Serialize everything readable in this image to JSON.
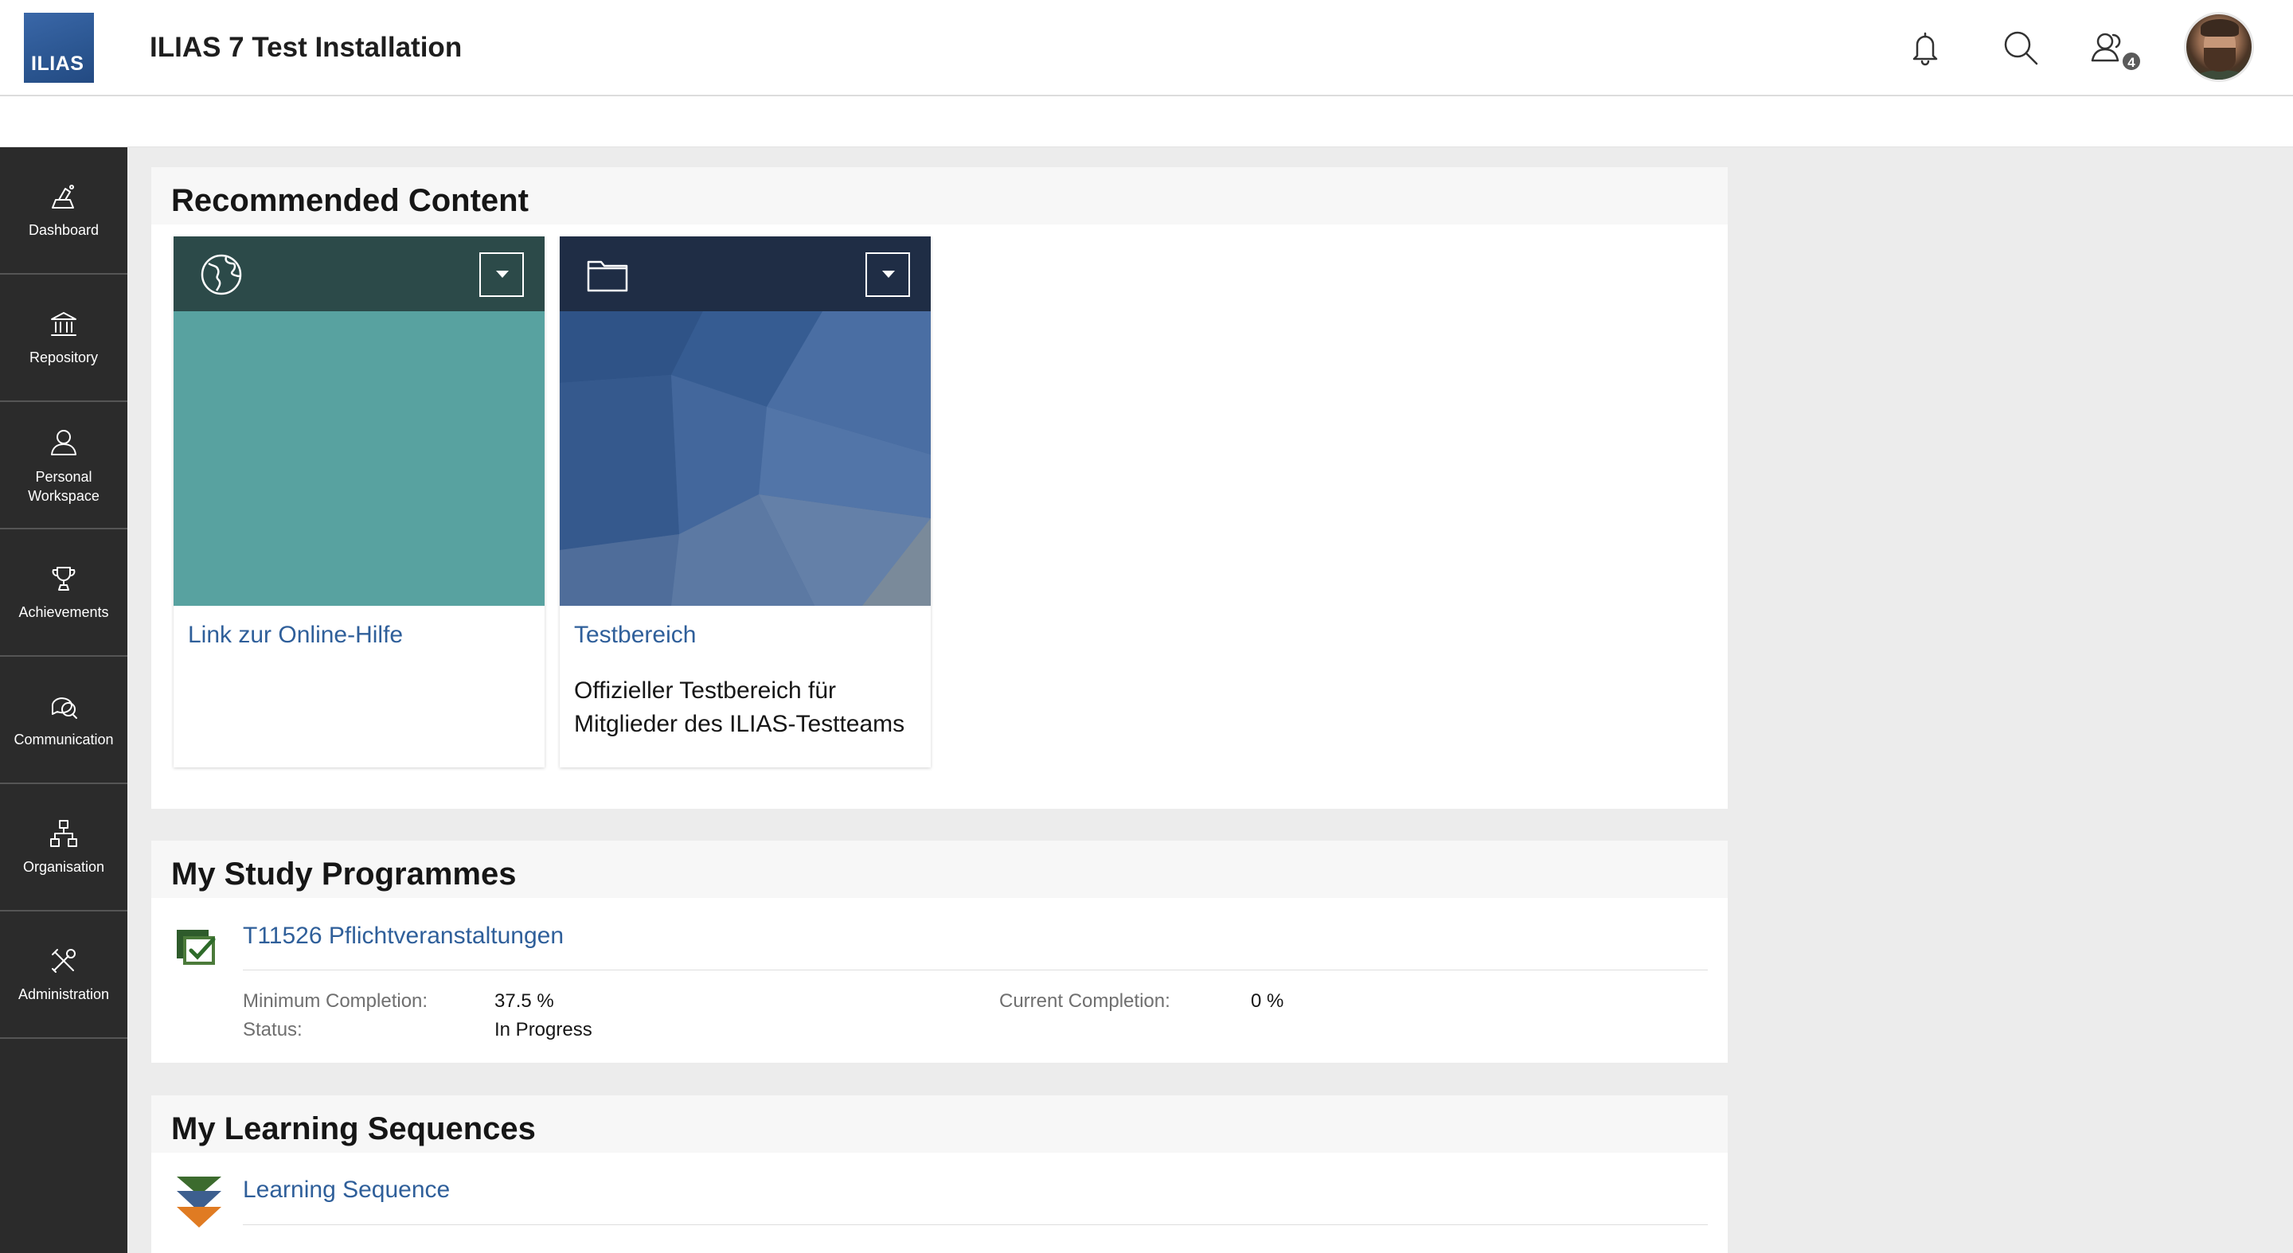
{
  "header": {
    "logo_text": "ILIAS",
    "title": "ILIAS 7 Test Installation",
    "icons": [
      "bell-icon",
      "search-icon",
      "contacts-icon"
    ],
    "contacts_badge": "4"
  },
  "mainbar": {
    "items": [
      {
        "label": "Dashboard",
        "icon": "dashboard-icon"
      },
      {
        "label": "Repository",
        "icon": "repository-icon"
      },
      {
        "label": "Personal\nWorkspace",
        "label_line1": "Personal",
        "label_line2": "Workspace",
        "icon": "person-icon"
      },
      {
        "label": "Achievements",
        "icon": "trophy-icon"
      },
      {
        "label": "Communication",
        "icon": "chat-icon"
      },
      {
        "label": "Organisation",
        "icon": "org-chart-icon"
      },
      {
        "label": "Administration",
        "icon": "tools-icon"
      }
    ]
  },
  "recommended": {
    "title": "Recommended Content",
    "cards": [
      {
        "title": "Link zur Online-Hilfe",
        "description": "",
        "type_icon": "globe-icon",
        "top_color": "#2c4a49",
        "image_color": "#58a2a0"
      },
      {
        "title": "Testbereich",
        "description": "Offizieller Testbereich für Mitglieder des ILIAS-Testteams",
        "type_icon": "folder-icon",
        "top_color": "#1f2d45",
        "image_color": "#3f6396"
      }
    ]
  },
  "study_programmes": {
    "title": "My Study Programmes",
    "item": {
      "title": "T11526 Pflichtveranstaltungen",
      "min_completion_label": "Minimum Completion:",
      "min_completion_value": "37.5 %",
      "current_completion_label": "Current Completion:",
      "current_completion_value": "0 %",
      "status_label": "Status:",
      "status_value": "In Progress"
    }
  },
  "learning_sequences": {
    "title": "My Learning Sequences",
    "item": {
      "title": "Learning Sequence"
    }
  }
}
